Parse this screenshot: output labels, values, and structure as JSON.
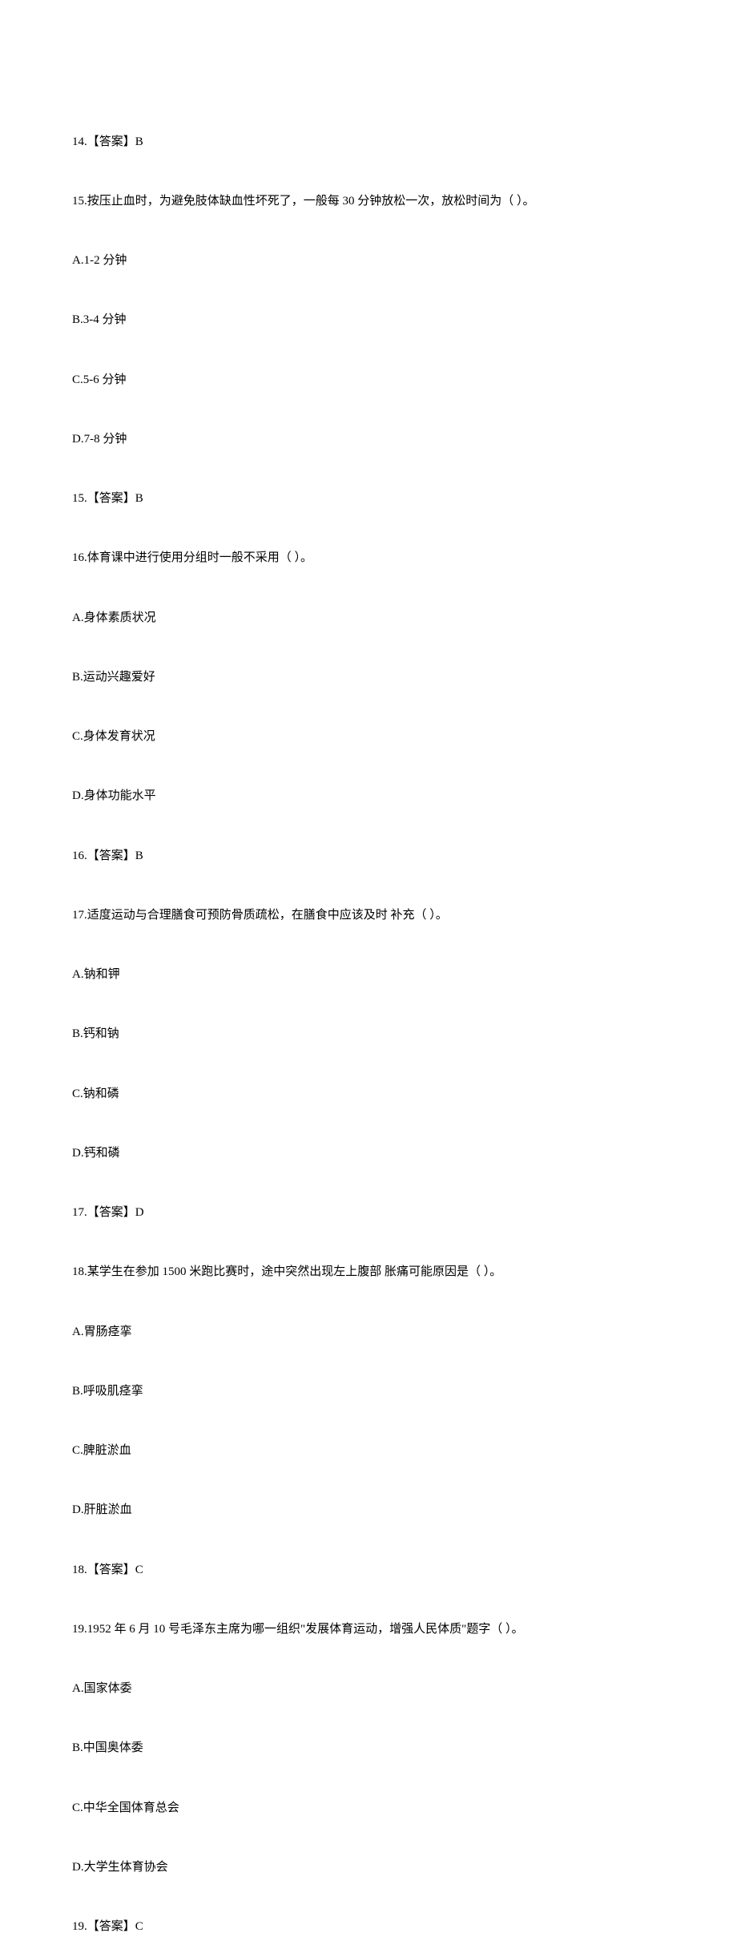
{
  "lines": [
    "14.【答案】B",
    "15.按压止血时，为避免肢体缺血性坏死了，一般每 30 分钟放松一次，放松时间为（ ）。",
    "A.1-2 分钟",
    "B.3-4 分钟",
    "C.5-6 分钟",
    "D.7-8 分钟",
    "15.【答案】B",
    "16.体育课中进行使用分组时一般不采用（ ）。",
    "A.身体素质状况",
    "B.运动兴趣爱好",
    "C.身体发育状况",
    "D.身体功能水平",
    "16.【答案】B",
    "17.适度运动与合理膳食可预防骨质疏松，在膳食中应该及时 补充（ ）。",
    "A.钠和钾",
    "B.钙和钠",
    "C.钠和磷",
    "D.钙和磷",
    "17.【答案】D",
    "18.某学生在参加 1500 米跑比赛时，途中突然出现左上腹部 胀痛可能原因是（ ）。",
    "A.胃肠痉挛",
    "B.呼吸肌痉挛",
    "C.脾脏淤血",
    "D.肝脏淤血",
    "18.【答案】C",
    "19.1952 年 6 月 10 号毛泽东主席为哪一组织\"发展体育运动，增强人民体质\"题字（ ）。",
    "A.国家体委",
    "B.中国奥体委",
    "C.中华全国体育总会",
    "D.大学生体育协会",
    "19.【答案】C"
  ]
}
